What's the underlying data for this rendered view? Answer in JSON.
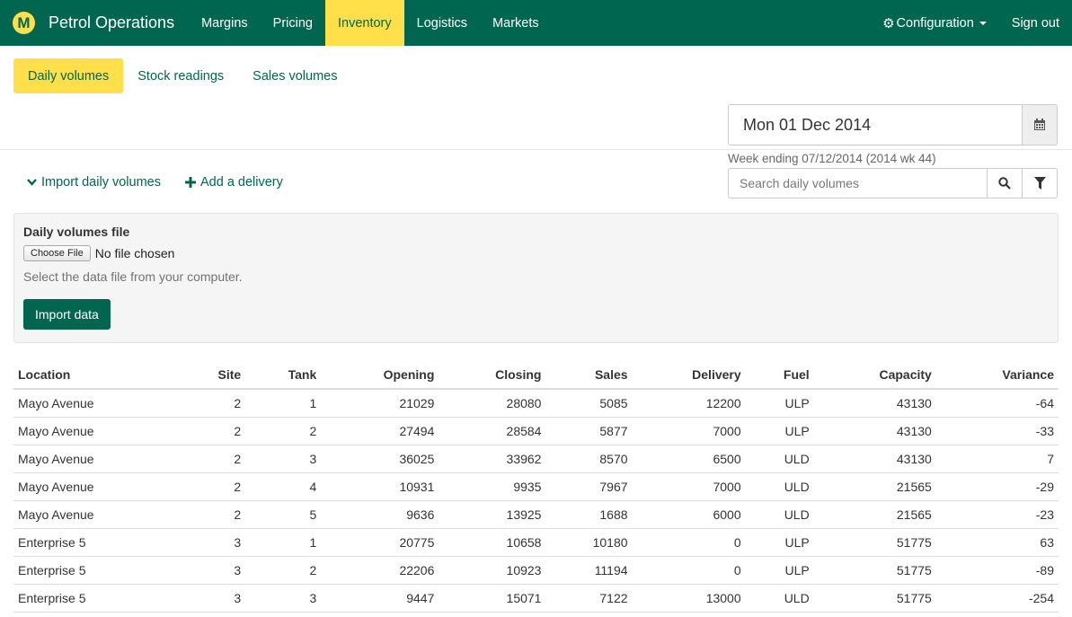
{
  "navbar": {
    "logo_letter": "M",
    "brand": "Petrol Operations",
    "items": [
      "Margins",
      "Pricing",
      "Inventory",
      "Logistics",
      "Markets"
    ],
    "active_index": 2,
    "configuration": "Configuration",
    "sign_out": "Sign out"
  },
  "tabs": {
    "items": [
      "Daily volumes",
      "Stock readings",
      "Sales volumes"
    ],
    "active_index": 0
  },
  "date": {
    "value": "Mon 01 Dec 2014",
    "week_ending": "Week ending 07/12/2014 (2014 wk 44)"
  },
  "actions": {
    "import": "Import daily volumes",
    "add_delivery": "Add a delivery"
  },
  "search": {
    "placeholder": "Search daily volumes"
  },
  "import_panel": {
    "title": "Daily volumes file",
    "choose_file": "Choose File",
    "no_file": "No file chosen",
    "help": "Select the data file from your computer.",
    "button": "Import data"
  },
  "table": {
    "columns": [
      "Location",
      "Site",
      "Tank",
      "Opening",
      "Closing",
      "Sales",
      "Delivery",
      "Fuel",
      "Capacity",
      "Variance"
    ],
    "rows": [
      [
        "Mayo Avenue",
        "2",
        "1",
        "21029",
        "28080",
        "5085",
        "12200",
        "ULP",
        "43130",
        "-64"
      ],
      [
        "Mayo Avenue",
        "2",
        "2",
        "27494",
        "28584",
        "5877",
        "7000",
        "ULP",
        "43130",
        "-33"
      ],
      [
        "Mayo Avenue",
        "2",
        "3",
        "36025",
        "33962",
        "8570",
        "6500",
        "ULD",
        "43130",
        "7"
      ],
      [
        "Mayo Avenue",
        "2",
        "4",
        "10931",
        "9935",
        "7967",
        "7000",
        "ULD",
        "21565",
        "-29"
      ],
      [
        "Mayo Avenue",
        "2",
        "5",
        "9636",
        "13925",
        "1688",
        "6000",
        "ULD",
        "21565",
        "-23"
      ],
      [
        "Enterprise 5",
        "3",
        "1",
        "20775",
        "10658",
        "10180",
        "0",
        "ULP",
        "51775",
        "63"
      ],
      [
        "Enterprise 5",
        "3",
        "2",
        "22206",
        "10923",
        "11194",
        "0",
        "ULP",
        "51775",
        "-89"
      ],
      [
        "Enterprise 5",
        "3",
        "3",
        "9447",
        "15071",
        "7122",
        "13000",
        "ULD",
        "51775",
        "-254"
      ]
    ]
  },
  "colors": {
    "brand_green": "#00664f",
    "accent_yellow": "#ffe04b"
  },
  "icons": {
    "calendar": "calendar-icon",
    "search": "search-icon",
    "filter": "filter-icon",
    "gear": "gear-icon",
    "chevron": "chevron-down-icon",
    "plus": "plus-icon"
  }
}
